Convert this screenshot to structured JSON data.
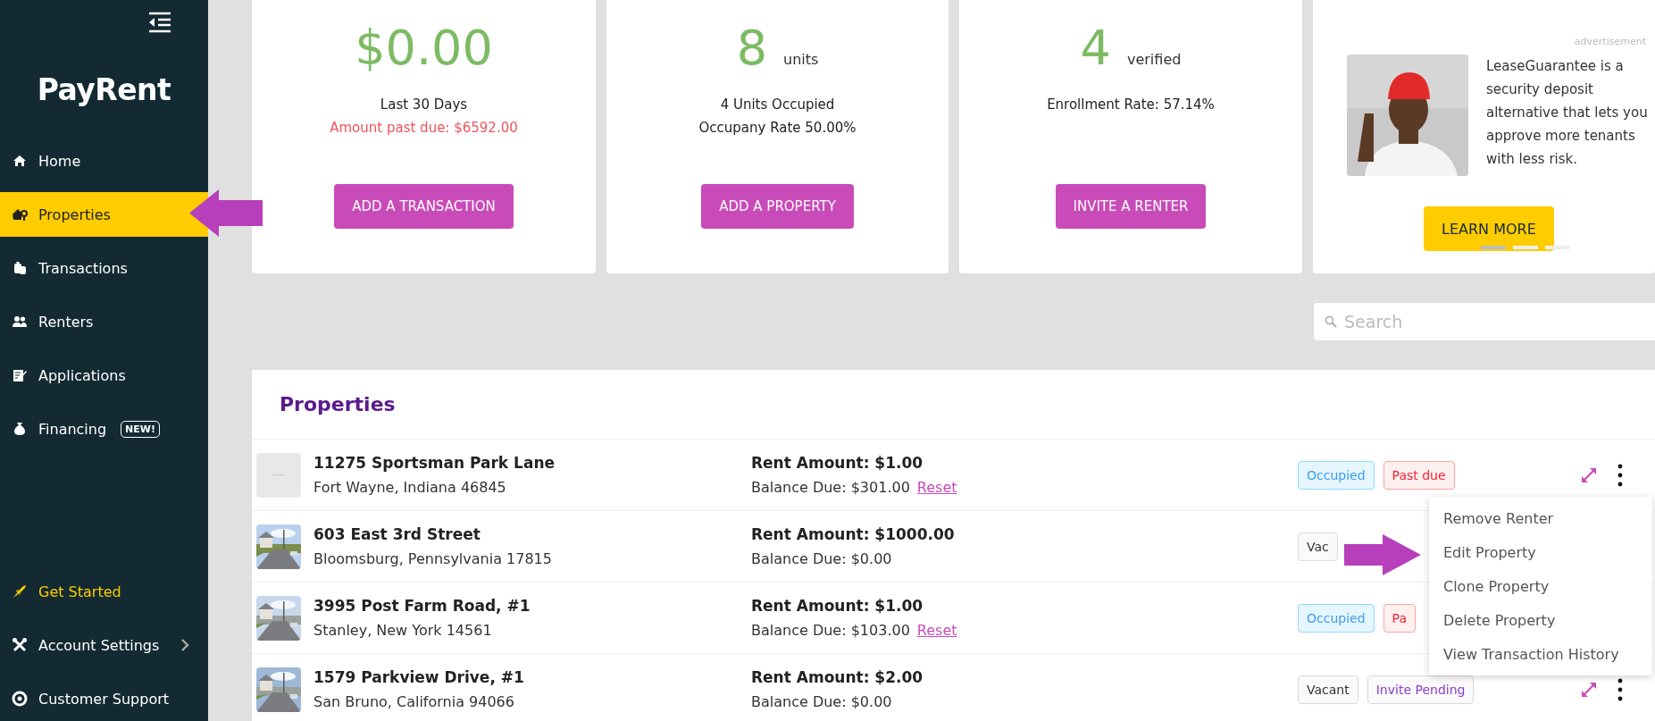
{
  "sidebar": {
    "logo": "PayRent",
    "items": [
      {
        "label": "Home",
        "selected": false
      },
      {
        "label": "Properties",
        "selected": true
      },
      {
        "label": "Transactions",
        "selected": false
      },
      {
        "label": "Renters",
        "selected": false
      },
      {
        "label": "Applications",
        "selected": false
      },
      {
        "label": "Financing",
        "selected": false,
        "badge": "NEW!"
      }
    ],
    "bottom_items": [
      {
        "label": "Get Started",
        "kind": "promo"
      },
      {
        "label": "Account Settings",
        "kind": "submenu"
      },
      {
        "label": "Customer Support",
        "kind": "link"
      }
    ]
  },
  "stat_cards": [
    {
      "value": "$0.00",
      "lines": [
        {
          "text": "Last 30 Days",
          "kind": "normal"
        },
        {
          "text": "Amount past due: $6592.00",
          "kind": "alert"
        }
      ],
      "button": "ADD A TRANSACTION"
    },
    {
      "value": "8",
      "unit": "units",
      "lines": [
        {
          "text": "4 Units Occupied",
          "kind": "normal"
        },
        {
          "text": "Occupany Rate 50.00%",
          "kind": "normal"
        }
      ],
      "button": "ADD A PROPERTY"
    },
    {
      "value": "4",
      "unit": "verified",
      "lines": [
        {
          "text": "Enrollment Rate: 57.14%",
          "kind": "normal"
        }
      ],
      "button": "INVITE A RENTER"
    }
  ],
  "ad": {
    "label": "advertisement",
    "text": "LeaseGuarantee is a security deposit alternative that lets you approve more tenants with less risk.",
    "button": "LEARN MORE",
    "dots": [
      {
        "selected": true
      },
      {
        "selected": false
      },
      {
        "selected": false
      }
    ]
  },
  "search": {
    "placeholder": "Search"
  },
  "properties": {
    "title": "Properties",
    "rows": [
      {
        "kind": "blank",
        "name": "11275 Sportsman Park Lane",
        "address": "Fort Wayne, Indiana 46845",
        "rent": "Rent Amount: $1.00",
        "balance": "Balance Due: $301.00",
        "reset": "Reset",
        "badges": [
          {
            "label": "Occupied",
            "kind": "occupied"
          },
          {
            "label": "Past due",
            "kind": "past_due"
          }
        ],
        "actions": true
      },
      {
        "kind": "picture",
        "name": "603 East 3rd Street",
        "address": "Bloomsburg, Pennsylvania 17815",
        "rent": "Rent Amount: $1000.00",
        "balance": "Balance Due: $0.00",
        "badges": [
          {
            "label": "Vac",
            "kind": "vacant"
          }
        ]
      },
      {
        "kind": "picture",
        "name": "3995 Post Farm Road, #1",
        "address": "Stanley, New York 14561",
        "rent": "Rent Amount: $1.00",
        "balance": "Balance Due: $103.00",
        "reset": "Reset",
        "badges": [
          {
            "label": "Occupied",
            "kind": "occupied"
          },
          {
            "label": "Pa",
            "kind": "past_due"
          }
        ]
      },
      {
        "kind": "picture",
        "name": "1579 Parkview Drive, #1",
        "address": "San Bruno, California 94066",
        "rent": "Rent Amount: $2.00",
        "balance": "Balance Due: $0.00",
        "badges": [
          {
            "label": "Vacant",
            "kind": "vacant"
          },
          {
            "label": "Invite Pending",
            "kind": "invite_pending"
          }
        ],
        "actions": true
      }
    ]
  },
  "context_menu": {
    "items": [
      "Remove Renter",
      "Edit Property",
      "Clone Property",
      "Delete Property",
      "View Transaction History"
    ]
  }
}
